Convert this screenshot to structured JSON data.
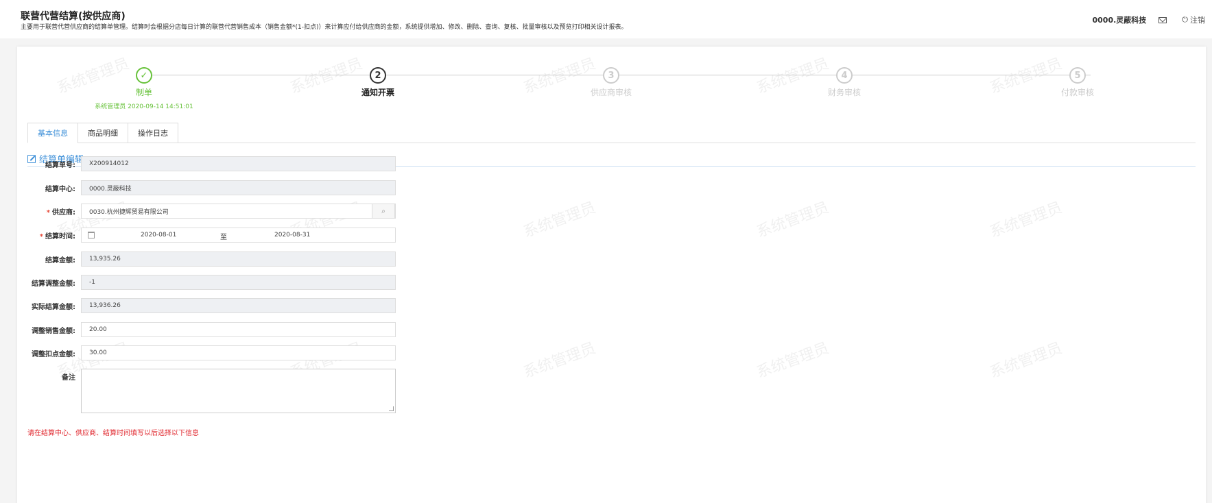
{
  "header": {
    "title": "联营代营结算(按供应商)",
    "description": "主要用于联营代营供应商的结算单管理。结算时会根据分店每日计算的联营代营销售成本（销售金额*(1-扣点)）来计算应付给供应商的金额，系统提供增加、修改、删除、查询、复核、批量审核以及预览打印相关设计报表。",
    "user": "0000.灵蔽科技",
    "logout_label": "注销"
  },
  "watermark_text": "系统管理员",
  "steps": [
    {
      "number": "✓",
      "title": "制单",
      "desc": "系统管理员 2020-09-14 14:51:01",
      "state": "done"
    },
    {
      "number": "2",
      "title": "通知开票",
      "desc": "",
      "state": "current"
    },
    {
      "number": "3",
      "title": "供应商审核",
      "desc": "",
      "state": "pending"
    },
    {
      "number": "4",
      "title": "财务审核",
      "desc": "",
      "state": "pending"
    },
    {
      "number": "5",
      "title": "付款审核",
      "desc": "",
      "state": "pending"
    }
  ],
  "tabs": [
    {
      "label": "基本信息",
      "active": true
    },
    {
      "label": "商品明细",
      "active": false
    },
    {
      "label": "操作日志",
      "active": false
    }
  ],
  "section_title": "结算单编辑",
  "form": {
    "bill_no": {
      "label": "结算单号:",
      "value": "X200914012"
    },
    "center": {
      "label": "结算中心:",
      "value": "0000.灵蔽科技"
    },
    "supplier": {
      "label": "供应商:",
      "value": "0030.杭州捷辉贸易有限公司",
      "required": true
    },
    "period": {
      "label": "结算时间:",
      "start": "2020-08-01",
      "sep": "至",
      "end": "2020-08-31",
      "required": true
    },
    "amount": {
      "label": "结算金额:",
      "value": "13,935.26"
    },
    "adjust_amount": {
      "label": "结算调整金额:",
      "value": "-1"
    },
    "actual_amount": {
      "label": "实际结算金额:",
      "value": "13,936.26"
    },
    "adjust_sales": {
      "label": "调整销售金额:",
      "value": "20.00"
    },
    "adjust_deduct": {
      "label": "调整扣点金额:",
      "value": "30.00"
    },
    "remark": {
      "label": "备注",
      "value": ""
    }
  },
  "warning": "请在结算中心、供应商、结算时间填写以后选择以下信息",
  "colors": {
    "accent": "#3d8fd8",
    "success": "#67c23a",
    "danger": "#e0272e"
  }
}
